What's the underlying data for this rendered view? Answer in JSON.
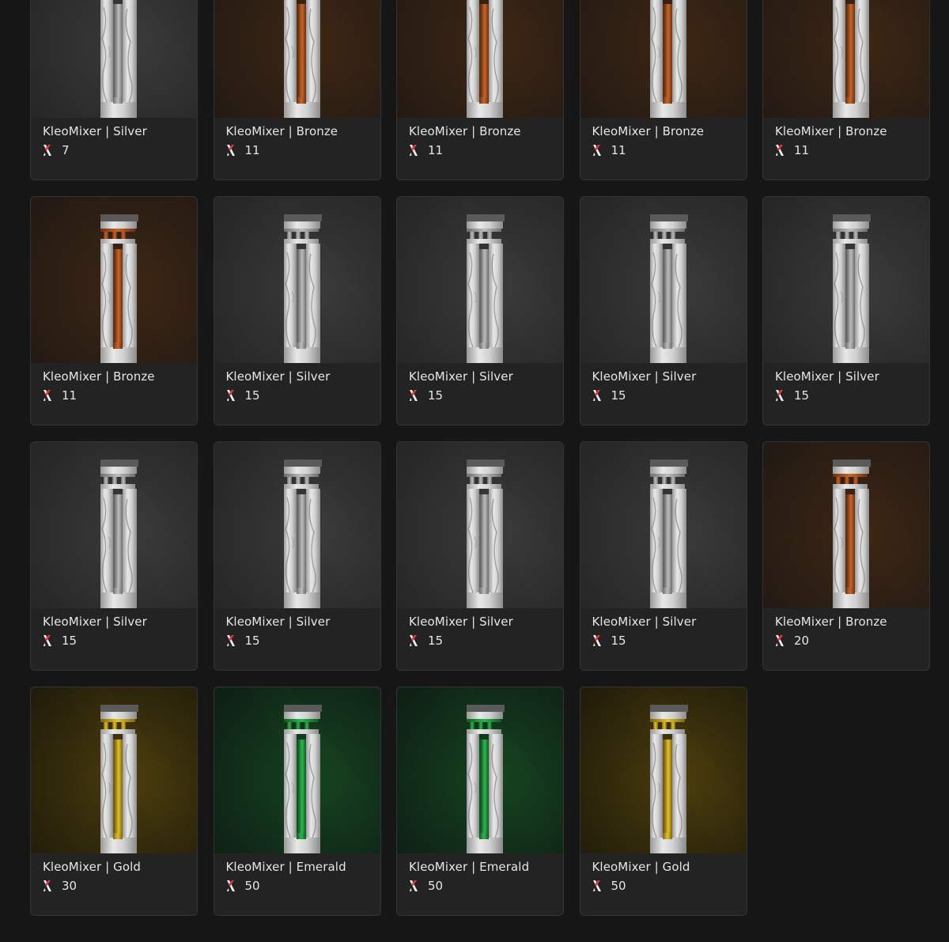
{
  "items": [
    {
      "name": "KleoMixer | Silver",
      "tier": "silver",
      "price": "7"
    },
    {
      "name": "KleoMixer | Bronze",
      "tier": "bronze",
      "price": "11"
    },
    {
      "name": "KleoMixer | Bronze",
      "tier": "bronze",
      "price": "11"
    },
    {
      "name": "KleoMixer | Bronze",
      "tier": "bronze",
      "price": "11"
    },
    {
      "name": "KleoMixer | Bronze",
      "tier": "bronze",
      "price": "11"
    },
    {
      "name": "KleoMixer | Bronze",
      "tier": "bronze",
      "price": "11"
    },
    {
      "name": "KleoMixer | Silver",
      "tier": "silver",
      "price": "15"
    },
    {
      "name": "KleoMixer | Silver",
      "tier": "silver",
      "price": "15"
    },
    {
      "name": "KleoMixer | Silver",
      "tier": "silver",
      "price": "15"
    },
    {
      "name": "KleoMixer | Silver",
      "tier": "silver",
      "price": "15"
    },
    {
      "name": "KleoMixer | Silver",
      "tier": "silver",
      "price": "15"
    },
    {
      "name": "KleoMixer | Silver",
      "tier": "silver",
      "price": "15"
    },
    {
      "name": "KleoMixer | Silver",
      "tier": "silver",
      "price": "15"
    },
    {
      "name": "KleoMixer | Silver",
      "tier": "silver",
      "price": "15"
    },
    {
      "name": "KleoMixer | Bronze",
      "tier": "bronze",
      "price": "20"
    },
    {
      "name": "KleoMixer | Gold",
      "tier": "gold",
      "price": "30"
    },
    {
      "name": "KleoMixer | Emerald",
      "tier": "emerald",
      "price": "50"
    },
    {
      "name": "KleoMixer | Emerald",
      "tier": "emerald",
      "price": "50"
    },
    {
      "name": "KleoMixer | Gold",
      "tier": "gold",
      "price": "50"
    }
  ],
  "price_icon": "kleo-coin-icon",
  "tier_colors": {
    "silver": {
      "bg": "#262626",
      "glow": "#3a3a3a",
      "trim": "#bdbdbd",
      "trim_dark": "#6e6e6e"
    },
    "bronze": {
      "bg": "#231a14",
      "glow": "#3d2614",
      "trim": "#c8662a",
      "trim_dark": "#6b3010"
    },
    "gold": {
      "bg": "#221d0b",
      "glow": "#4a3c0c",
      "trim": "#e3c02d",
      "trim_dark": "#7a6410"
    },
    "emerald": {
      "bg": "#0f2016",
      "glow": "#15431f",
      "trim": "#2fb54e",
      "trim_dark": "#0f5a22"
    }
  },
  "accent_red": "#e0383b"
}
